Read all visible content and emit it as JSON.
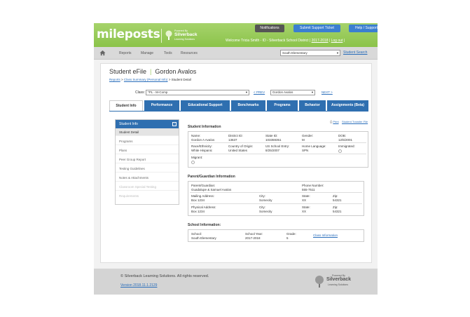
{
  "brand": {
    "logo": "mileposts",
    "powered_by": "Powered By",
    "partner": "Silverback",
    "partner_tag": "Learning Solutions"
  },
  "top_buttons": {
    "notifications": "Notifications",
    "support_ticket": "Submit Support Ticket",
    "help": "Help / Support"
  },
  "welcome": {
    "text": "Welcome Tricia Smith - ID - Silverback School District |",
    "year": "2017-2018",
    "logout": "Log out"
  },
  "nav": {
    "items": [
      "Reports",
      "Manage",
      "Tools",
      "Resources"
    ],
    "school": "South Elementary",
    "student_search": "Student Search"
  },
  "page": {
    "title": "Student eFile",
    "student": "Gordon Avalos",
    "breadcrumb": {
      "reports": "Reports",
      "class_summary": "Class Summary (Personal Info)",
      "current": "> Student Detail"
    }
  },
  "class_selector": {
    "label": "Class:",
    "class_value": "*PL - M-Comp",
    "prev": "< PREV",
    "student_value": "Gordon Avalos",
    "next": "NEXT >"
  },
  "tabs": [
    "Student Info",
    "Performance",
    "Educational Support",
    "Benchmarks",
    "Programs",
    "Behavior",
    "Assignments (Beta)"
  ],
  "sidebar": {
    "header": "Student Info",
    "toggle": "−",
    "items": [
      "Student Detail",
      "Programs",
      "Plans",
      "Peer Group Report",
      "Testing Guidelines",
      "Notes & Attachments",
      "Classroom Special Testing",
      "Requirements"
    ]
  },
  "print_links": {
    "print": "Print",
    "transfer": "Student Transfer File"
  },
  "student_information": {
    "title": "Student Information",
    "row1": [
      {
        "label": "Name:",
        "value": "Gordon A Avalos"
      },
      {
        "label": "District ID:",
        "value": "13637"
      },
      {
        "label": "State ID:",
        "value": "103359351"
      },
      {
        "label": "Gender:",
        "value": "M"
      },
      {
        "label": "DOB:",
        "value": "12/5/2001"
      }
    ],
    "row2": [
      {
        "label": "Race/Ethnicity:",
        "value": "White Hispanic"
      },
      {
        "label": "Country of Origin:",
        "value": "United States"
      },
      {
        "label": "US School Entry:",
        "value": "8/25/2007"
      },
      {
        "label": "Home Language:",
        "value": "SPN"
      },
      {
        "label": "Immigrated:",
        "value": ""
      }
    ],
    "migrant": {
      "label": "Migrant:"
    }
  },
  "guardian_information": {
    "title": "Parent/Guardian Information",
    "guardian": {
      "label": "Parent/Guardian:",
      "value": "Guadalupe & Samuel Avalos"
    },
    "phone": {
      "label": "Phone Number:",
      "value": "555-7511"
    },
    "mailing": [
      {
        "label": "Mailing Address:",
        "value": "Box 1234"
      },
      {
        "label": "City:",
        "value": "Somecity"
      },
      {
        "label": "State:",
        "value": "XX"
      },
      {
        "label": "Zip:",
        "value": "54321"
      }
    ],
    "physical": [
      {
        "label": "Physical Address:",
        "value": "Box 1234"
      },
      {
        "label": "City:",
        "value": "Somecity"
      },
      {
        "label": "State:",
        "value": "XX"
      },
      {
        "label": "Zip:",
        "value": "54321"
      }
    ]
  },
  "school_information": {
    "title": "School Information:",
    "school": {
      "label": "School:",
      "value": "South Elementary"
    },
    "year": {
      "label": "School Year:",
      "value": "2017-2018"
    },
    "grade": {
      "label": "Grade:",
      "value": "5"
    },
    "class_info": "Class Information"
  },
  "footer": {
    "copyright": "© Silverback Learning Solutions. All rights reserved.",
    "version": "Version 2018.11.1.2129",
    "powered_by": "Powered By",
    "partner": "Silverback",
    "partner_tag": "Learning Solutions"
  },
  "colors": {
    "brand_green": "#8bc34a",
    "tab_blue": "#2f6fb0",
    "notifications_btn": "#555555",
    "support_btn": "#3b7fd0",
    "link": "#2a6ebb"
  }
}
